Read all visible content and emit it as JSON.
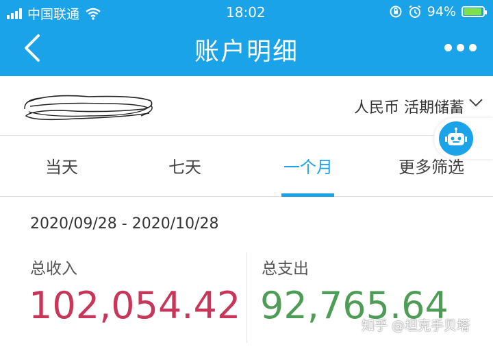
{
  "status_bar": {
    "carrier": "中国联通",
    "time": "18:02",
    "battery_percent": "94%",
    "battery_level": 0.94
  },
  "nav": {
    "title": "账户明细"
  },
  "account": {
    "type": "人民币 活期储蓄"
  },
  "tabs": [
    {
      "label": "当天"
    },
    {
      "label": "七天"
    },
    {
      "label": "一个月",
      "active": true
    },
    {
      "label": "更多筛选"
    }
  ],
  "summary": {
    "date_range": "2020/09/28 - 2020/10/28",
    "income_label": "总收入",
    "income_value": "102,054.42",
    "expense_label": "总支出",
    "expense_value": "92,765.64"
  },
  "watermark": "知乎 @坦克手贝塔",
  "colors": {
    "accent": "#1aa3e8",
    "income": "#c8365a",
    "expense": "#4e9d56"
  }
}
